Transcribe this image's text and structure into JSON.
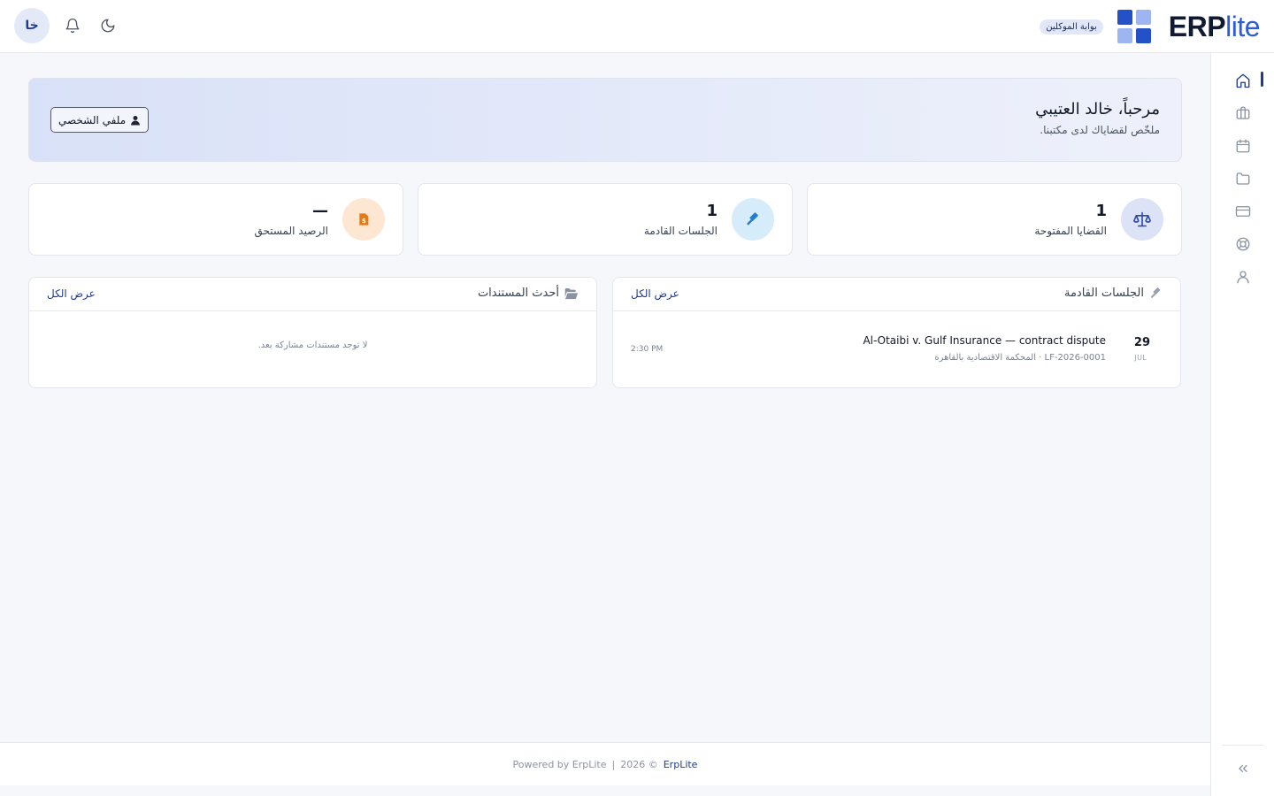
{
  "header": {
    "avatar_initials": "خا",
    "portal_badge": "بوابة الموكلين",
    "logo": {
      "erp": "ERP",
      "lite": "lite"
    },
    "icons": [
      "moon-icon",
      "bell-icon"
    ]
  },
  "sidebar": {
    "items": [
      {
        "icon": "home-icon",
        "active": true
      },
      {
        "icon": "briefcase-icon",
        "active": false
      },
      {
        "icon": "calendar-icon",
        "active": false
      },
      {
        "icon": "folder-icon",
        "active": false
      },
      {
        "icon": "credit-card-icon",
        "active": false
      },
      {
        "icon": "lifebuoy-icon",
        "active": false
      },
      {
        "icon": "user-icon",
        "active": false
      }
    ],
    "collapse_icon": "chevrons-left-icon"
  },
  "banner": {
    "title": "مرحباً، خالد العتيبي",
    "subtitle": "ملخّص لقضاياك لدى مكتبنا.",
    "profile_button": "ملفي الشخصي"
  },
  "stats": [
    {
      "value": "1",
      "label": "القضايا المفتوحة",
      "icon": "scale-icon"
    },
    {
      "value": "1",
      "label": "الجلسات القادمة",
      "icon": "gavel-icon"
    },
    {
      "value": "—",
      "label": "الرصيد المستحق",
      "icon": "invoice-icon"
    }
  ],
  "sessions_panel": {
    "title": "الجلسات القادمة",
    "view_all": "عرض الكل",
    "items": [
      {
        "day": "29",
        "month": "JUL",
        "title": "Al-Otaibi v. Gulf Insurance — contract dispute",
        "subtitle": "LF-2026-0001 · المحكمة الاقتصادية بالقاهرة",
        "time": "2:30 PM"
      }
    ]
  },
  "documents_panel": {
    "title": "أحدث المستندات",
    "view_all": "عرض الكل",
    "empty": "لا توجد مستندات مشاركة بعد."
  },
  "footer": {
    "powered": "Powered by ErpLite",
    "separator": "|",
    "copyright": "2026 ©",
    "brand": "ErpLite"
  },
  "colors": {
    "accent": "#1f3a93",
    "logo_blue": "#2e5bd9",
    "stat1_bg": "#dde3f7",
    "stat2_bg": "#d6ecfb",
    "stat3_bg": "#fde6d2"
  }
}
